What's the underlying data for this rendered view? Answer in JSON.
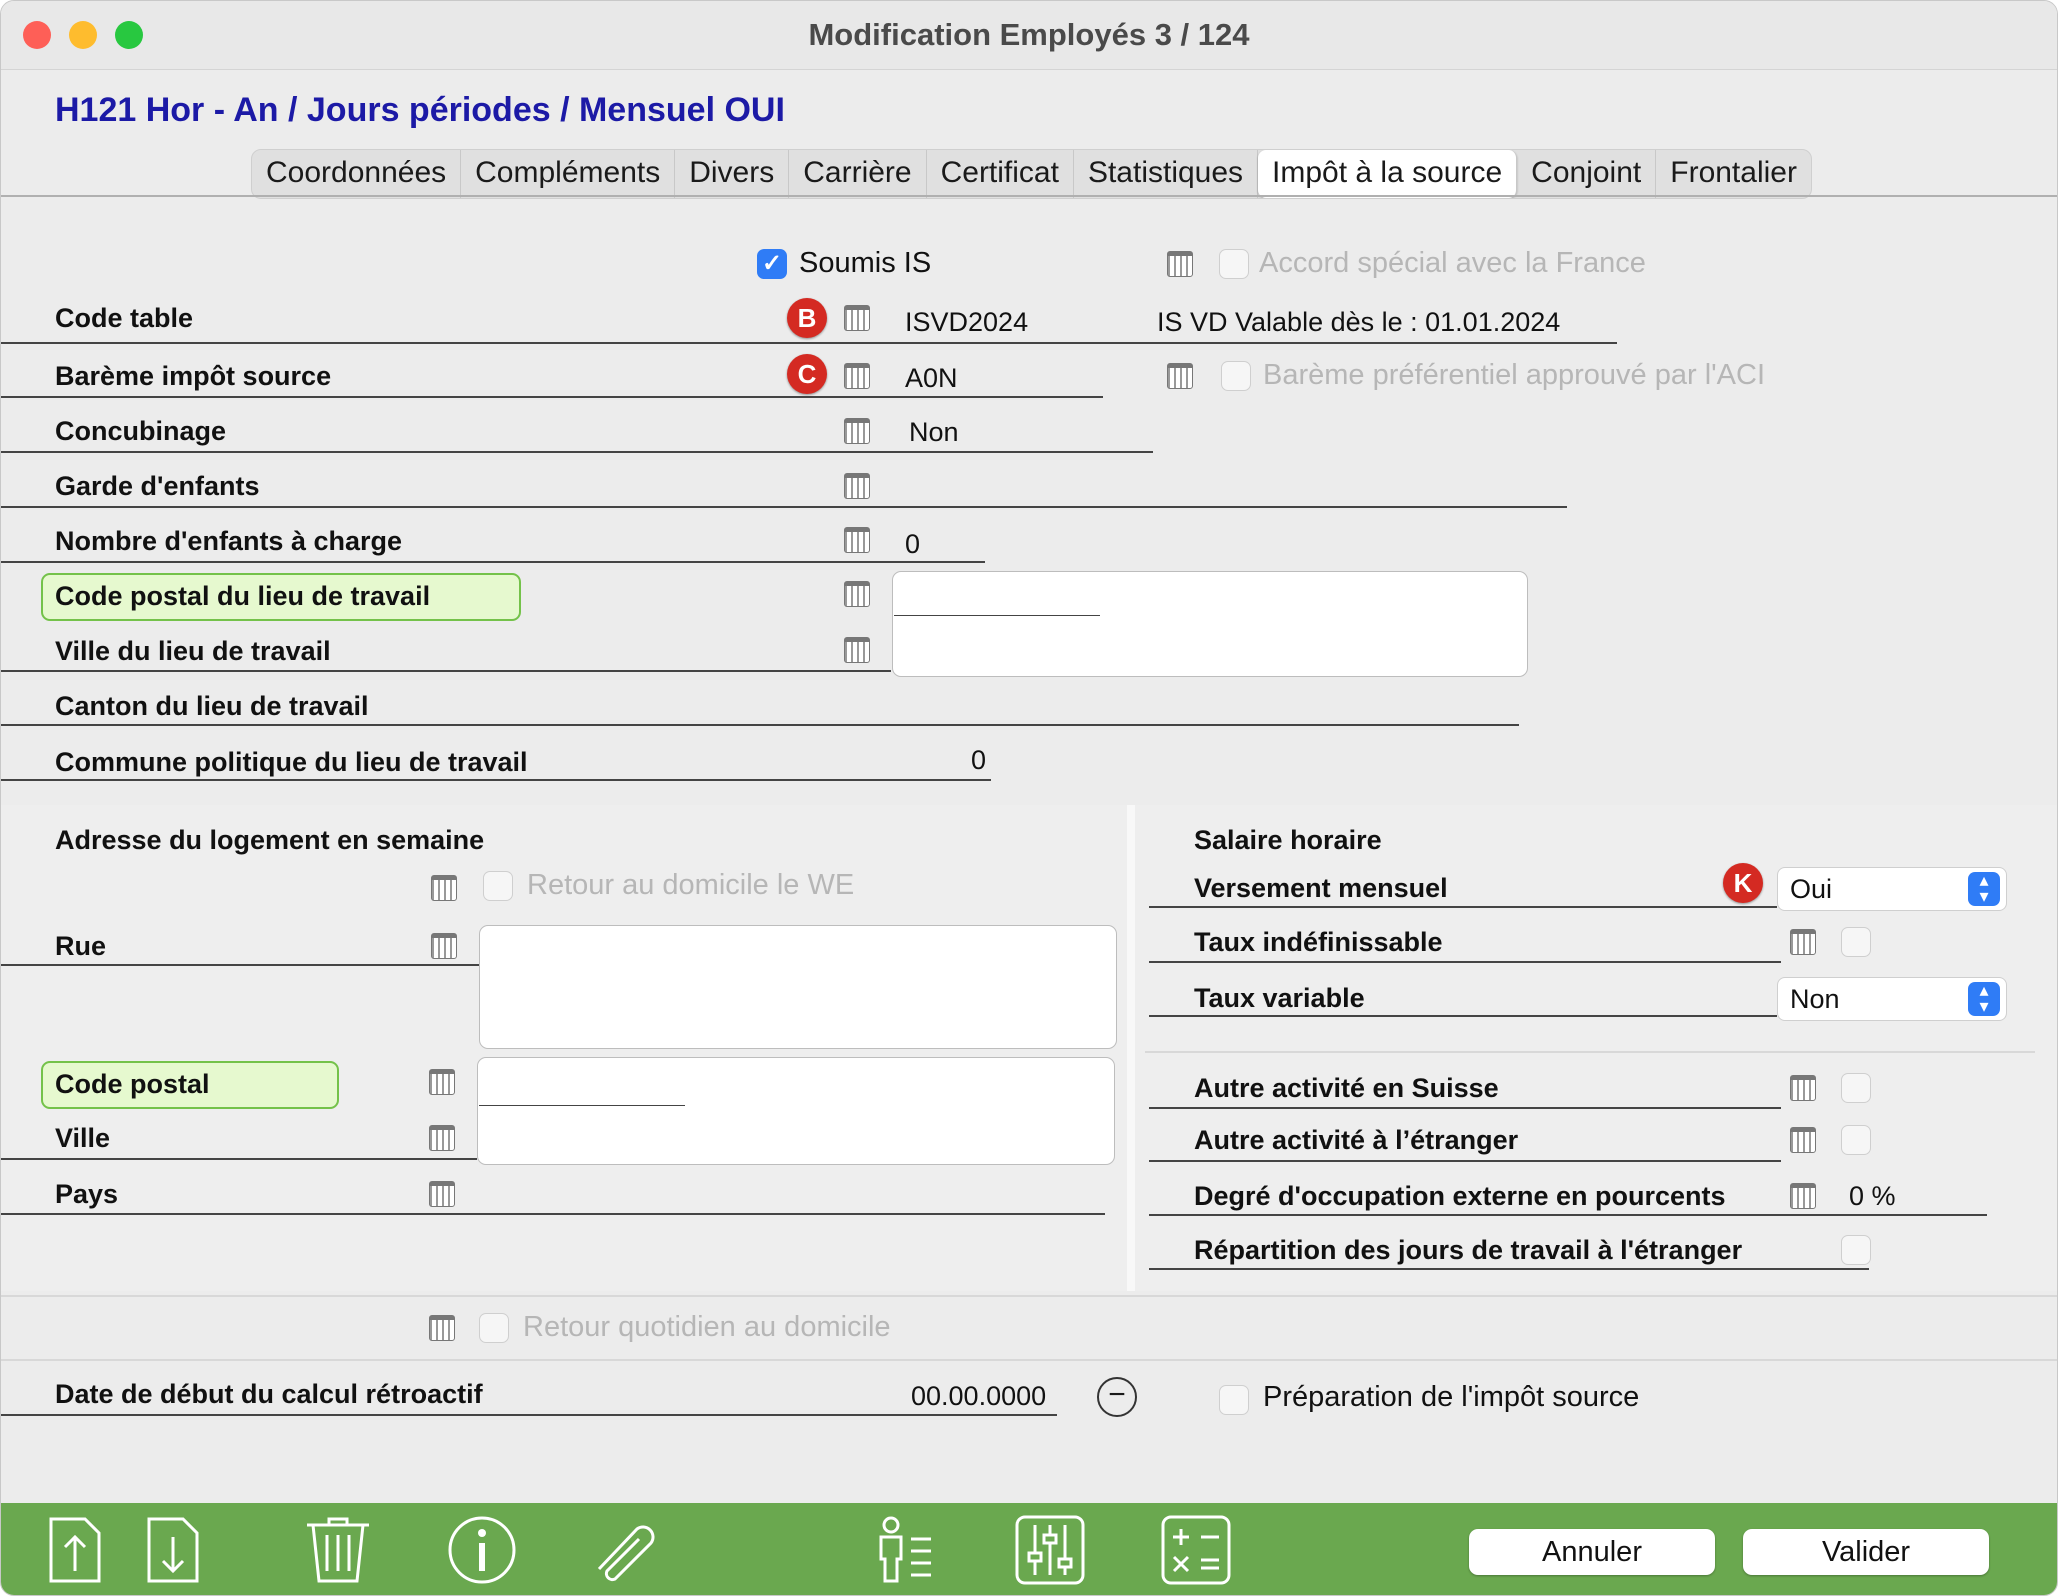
{
  "window": {
    "title": "Modification Employés   3 / 124"
  },
  "subtitle": "H121 Hor - An / Jours périodes / Mensuel OUI",
  "tabs": [
    {
      "label": "Coordonnées"
    },
    {
      "label": "Compléments"
    },
    {
      "label": "Divers"
    },
    {
      "label": "Carrière"
    },
    {
      "label": "Certificat"
    },
    {
      "label": "Statistiques"
    },
    {
      "label": "Impôt à la source",
      "active": true
    },
    {
      "label": "Conjoint"
    },
    {
      "label": "Frontalier"
    }
  ],
  "top": {
    "soumis_is": {
      "label": "Soumis IS",
      "checked": true
    },
    "accord_special": {
      "label": "Accord spécial avec la France",
      "checked": false
    },
    "code_table": {
      "label": "Code table",
      "badge": "B",
      "value": "ISVD2024",
      "info": "IS VD Valable dès le : 01.01.2024"
    },
    "bareme": {
      "label": "Barème impôt source",
      "badge": "C",
      "value": "A0N"
    },
    "bareme_pref": {
      "label": "Barème préférentiel approuvé par l'ACI",
      "checked": false
    },
    "concubinage": {
      "label": "Concubinage",
      "value": "Non"
    },
    "garde_enfants": {
      "label": "Garde d'enfants",
      "value": ""
    },
    "nb_enfants": {
      "label": "Nombre d'enfants à charge",
      "value": "0"
    },
    "code_postal_travail": {
      "label": "Code postal du lieu de travail",
      "value": ""
    },
    "ville_travail": {
      "label": "Ville du lieu de travail",
      "value": ""
    },
    "canton_travail": {
      "label": "Canton du lieu de travail",
      "value": ""
    },
    "commune_travail": {
      "label": "Commune politique du lieu de travail",
      "value": "0"
    }
  },
  "logement": {
    "heading": "Adresse du logement en semaine",
    "retour_we": {
      "label": "Retour au domicile le WE",
      "checked": false
    },
    "rue": {
      "label": "Rue",
      "value": ""
    },
    "code_postal": {
      "label": "Code postal",
      "value": ""
    },
    "ville": {
      "label": "Ville",
      "value": ""
    },
    "pays": {
      "label": "Pays",
      "value": ""
    }
  },
  "salaire": {
    "heading": "Salaire horaire",
    "versement": {
      "label": "Versement mensuel",
      "badge": "K",
      "value": "Oui"
    },
    "taux_indef": {
      "label": "Taux indéfinissable",
      "checked": false
    },
    "taux_variable": {
      "label": "Taux variable",
      "value": "Non"
    },
    "autre_suisse": {
      "label": "Autre activité en Suisse",
      "checked": false
    },
    "autre_etranger": {
      "label": "Autre activité à l’étranger",
      "checked": false
    },
    "degre_occupation": {
      "label": "Degré d'occupation externe en pourcents",
      "value": "0 %"
    },
    "repartition": {
      "label": "Répartition des jours de travail à l'étranger",
      "checked": false
    }
  },
  "bottom_section": {
    "retour_quotidien": {
      "label": "Retour quotidien au domicile",
      "checked": false
    },
    "date_retro": {
      "label": "Date de début du calcul rétroactif",
      "value": "00.00.0000"
    },
    "preparation": {
      "label": "Préparation de l'impôt source",
      "checked": false
    }
  },
  "toolbar": {
    "icons": [
      "export-icon",
      "import-icon",
      "trash-icon",
      "info-icon",
      "attachment-icon",
      "person-list-icon",
      "sliders-icon",
      "calculator-icon"
    ],
    "cancel_label": "Annuler",
    "ok_label": "Valider"
  }
}
